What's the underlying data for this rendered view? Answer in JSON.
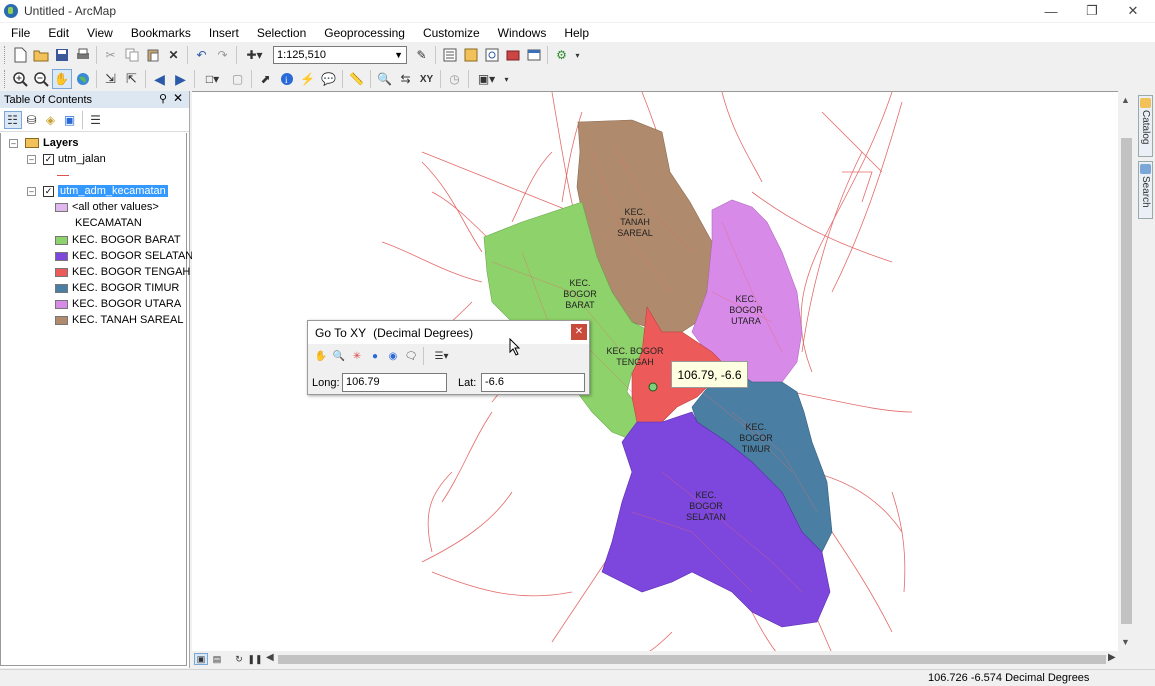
{
  "window": {
    "title": "Untitled - ArcMap"
  },
  "menu": [
    "File",
    "Edit",
    "View",
    "Bookmarks",
    "Insert",
    "Selection",
    "Geoprocessing",
    "Customize",
    "Windows",
    "Help"
  ],
  "toolbar": {
    "scale": "1:125,510"
  },
  "toc": {
    "title": "Table Of Contents",
    "root": "Layers",
    "layer1": "utm_jalan",
    "layer2": "utm_adm_kecamatan",
    "other_values": "<all other values>",
    "field": "KECAMATAN",
    "classes": [
      {
        "label": "KEC. BOGOR BARAT",
        "color": "#8ed26b"
      },
      {
        "label": "KEC. BOGOR SELATAN",
        "color": "#7d46dc"
      },
      {
        "label": "KEC. BOGOR TENGAH",
        "color": "#ec5a5a"
      },
      {
        "label": "KEC. BOGOR TIMUR",
        "color": "#4a7fa3"
      },
      {
        "label": "KEC. BOGOR UTARA",
        "color": "#d88ae8"
      },
      {
        "label": "KEC. TANAH SAREAL",
        "color": "#b08a6c"
      }
    ],
    "other_color": "#e0b8ee"
  },
  "map": {
    "labels": {
      "tanah": [
        "KEC.",
        "TANAH",
        "SAREAL"
      ],
      "barat": [
        "KEC.",
        "BOGOR",
        "BARAT"
      ],
      "utara": [
        "KEC.",
        "BOGOR",
        "UTARA"
      ],
      "tengah": [
        "KEC. BOGOR",
        "TENGAH"
      ],
      "timur": [
        "KEC.",
        "BOGOR",
        "TIMUR"
      ],
      "selatan": [
        "KEC.",
        "BOGOR",
        "SELATAN"
      ]
    },
    "callout": "106.79, -6.6"
  },
  "gotoxy": {
    "title": "Go To XY",
    "units": "(Decimal Degrees)",
    "long_label": "Long:",
    "long_value": "106.79",
    "lat_label": "Lat:",
    "lat_value": "-6.6"
  },
  "sidepanel": {
    "catalog": "Catalog",
    "search": "Search"
  },
  "status": {
    "coords": "106.726  -6.574 Decimal Degrees"
  }
}
